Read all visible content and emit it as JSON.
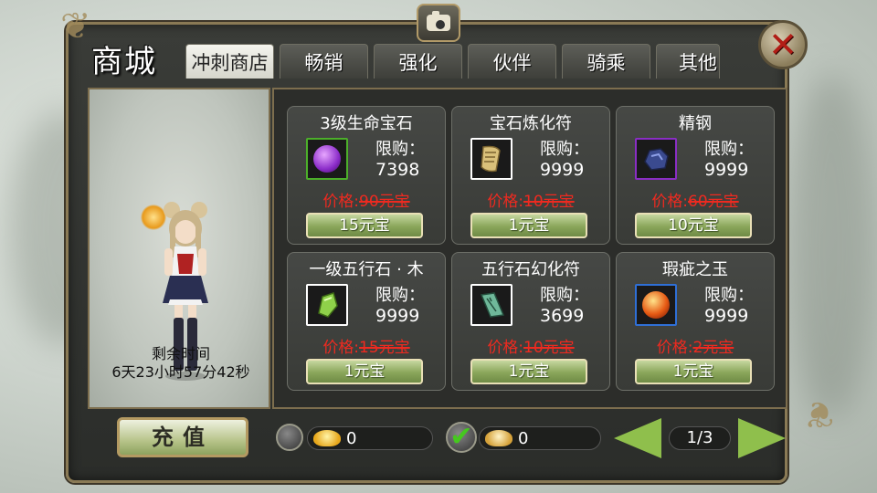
{
  "header": {
    "title": "商城"
  },
  "tabs": [
    {
      "label": "冲刺商店",
      "active": true
    },
    {
      "label": "畅销"
    },
    {
      "label": "强化"
    },
    {
      "label": "伙伴"
    },
    {
      "label": "骑乘"
    },
    {
      "label": "其他"
    }
  ],
  "character": {
    "remain_label": "剩余时间",
    "remain_value": "6天23小时57分42秒"
  },
  "items": [
    {
      "name": "3级生命宝石",
      "limit_label": "限购：",
      "limit": "7398",
      "price_prefix": "价格:",
      "old_price": "90元宝",
      "buy_label": "15元宝",
      "icon": "purple-gem-icon",
      "icon_color": "#8b2cc9",
      "frame_color": "#4caf2a"
    },
    {
      "name": "宝石炼化符",
      "limit_label": "限购：",
      "limit": "9999",
      "price_prefix": "价格:",
      "old_price": "10元宝",
      "buy_label": "1元宝",
      "icon": "scroll-icon",
      "icon_color": "#d9c07a",
      "frame_color": "#ffffff"
    },
    {
      "name": "精钢",
      "limit_label": "限购：",
      "limit": "9999",
      "price_prefix": "价格:",
      "old_price": "60元宝",
      "buy_label": "10元宝",
      "icon": "ore-icon",
      "icon_color": "#3a4a8f",
      "frame_color": "#8a2ec4"
    },
    {
      "name": "一级五行石 · 木",
      "limit_label": "限购：",
      "limit": "9999",
      "price_prefix": "价格:",
      "old_price": "15元宝",
      "buy_label": "1元宝",
      "icon": "green-stone-icon",
      "icon_color": "#8fd14a",
      "frame_color": "#ffffff"
    },
    {
      "name": "五行石幻化符",
      "limit_label": "限购：",
      "limit": "3699",
      "price_prefix": "价格:",
      "old_price": "10元宝",
      "buy_label": "1元宝",
      "icon": "talisman-icon",
      "icon_color": "#6fb89a",
      "frame_color": "#ffffff"
    },
    {
      "name": "瑕疵之玉",
      "limit_label": "限购：",
      "limit": "9999",
      "price_prefix": "价格:",
      "old_price": "2元宝",
      "buy_label": "1元宝",
      "icon": "fire-orb-icon",
      "icon_color": "#e65a14",
      "frame_color": "#2f6fd6"
    }
  ],
  "footer": {
    "recharge_label": "充值",
    "balance_gold": "0",
    "balance_bound": "0",
    "page": "1/3"
  },
  "colors": {
    "price_red": "#ee2a20",
    "button_green": "#8aa65a",
    "frame_gold": "#8a7a55"
  }
}
